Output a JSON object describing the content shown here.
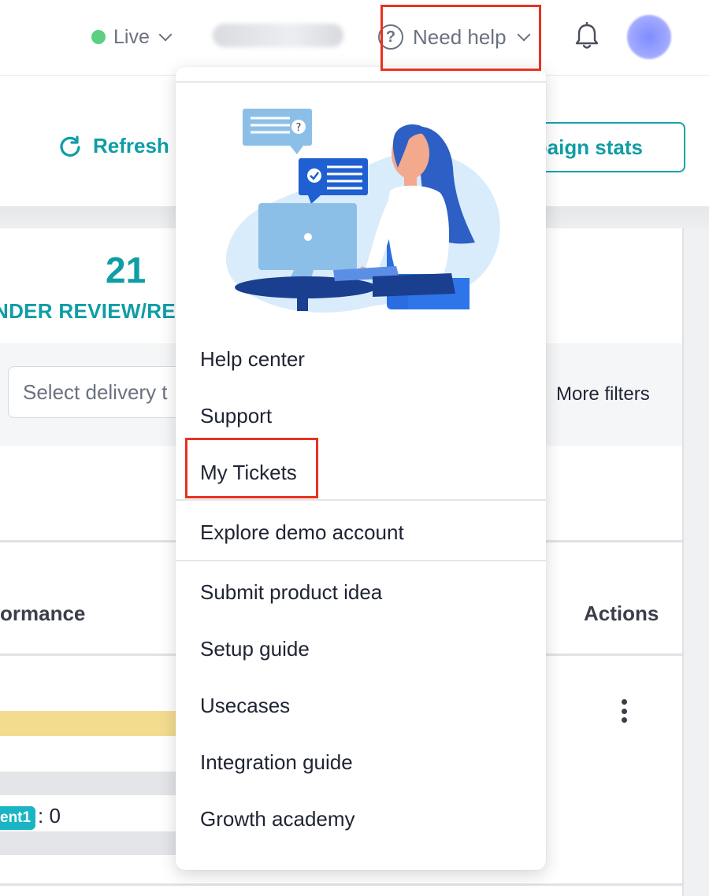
{
  "header": {
    "environment_label": "Live",
    "help_label": "Need help",
    "help_icon_glyph": "?"
  },
  "toolbar": {
    "refresh_label": "Refresh",
    "campaign_stats_label": "paign stats"
  },
  "summary": {
    "count": "21",
    "label": "NDER REVIEW/RE"
  },
  "filters": {
    "delivery_placeholder": "Select delivery t",
    "more_filters_label": "More filters"
  },
  "table": {
    "col_performance": "ormance",
    "col_actions": "Actions",
    "row_tag": "ent1",
    "row_tag_count": ": 0"
  },
  "help_menu": {
    "illustration_badge": "?",
    "items": [
      {
        "label": "Help center"
      },
      {
        "label": "Support"
      },
      {
        "label": "My Tickets"
      },
      {
        "label": "Explore demo account"
      },
      {
        "label": "Submit product idea"
      },
      {
        "label": "Setup guide"
      },
      {
        "label": "Usecases"
      },
      {
        "label": "Integration guide"
      },
      {
        "label": "Growth academy"
      }
    ]
  },
  "colors": {
    "accent_teal": "#0f9da6",
    "live_green": "#5ccf82",
    "highlight_red": "#e8321f"
  }
}
